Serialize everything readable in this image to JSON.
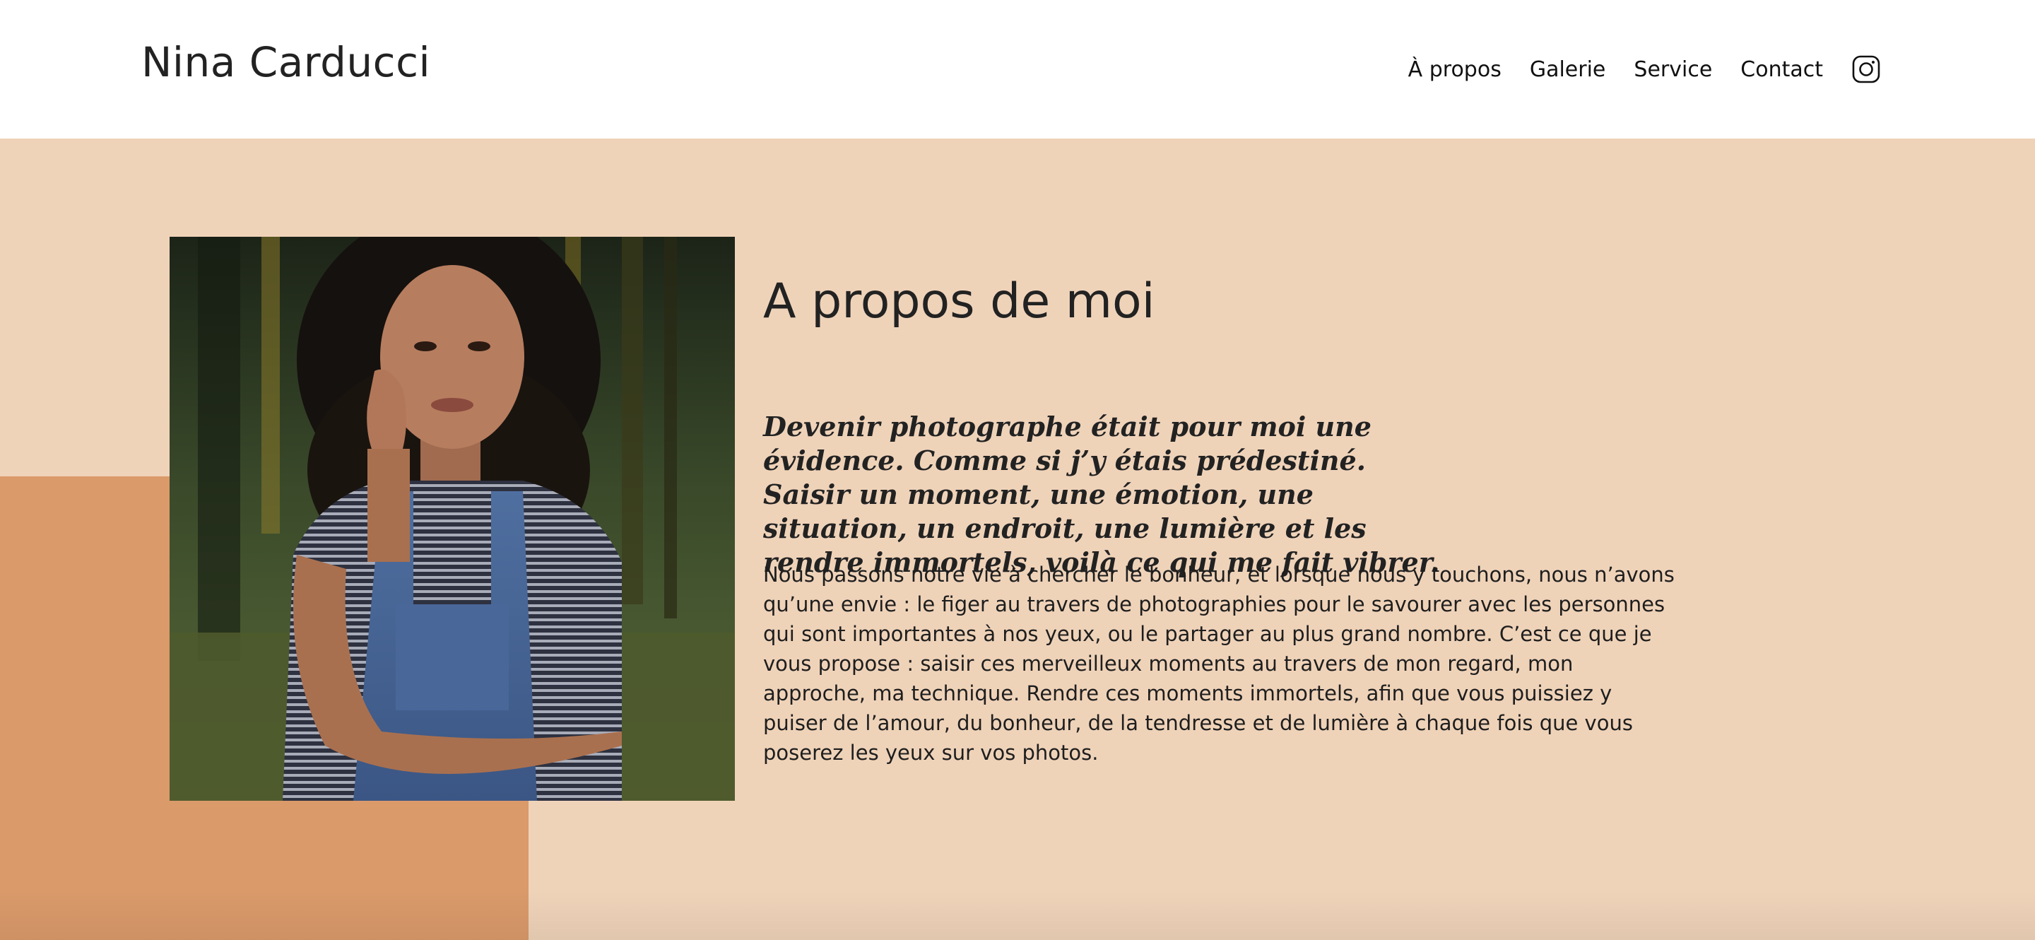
{
  "header": {
    "brand": "Nina Carducci",
    "nav": [
      {
        "label": "À propos"
      },
      {
        "label": "Galerie"
      },
      {
        "label": "Service"
      },
      {
        "label": "Contact"
      }
    ],
    "social_icon": "instagram-icon"
  },
  "about": {
    "title": "A propos de moi",
    "quote": "Devenir photographe était pour moi une évidence. Comme si j’y étais prédestiné. Saisir un moment, une émotion, une situation, un endroit, une lumière et les rendre immortels, voilà ce qui me fait vibrer.",
    "body": "Nous passons notre vie à chercher le bonheur, et lorsque nous y touchons, nous n’avons qu’une envie : le figer au travers de photographies pour le savourer avec les personnes qui sont importantes à nos yeux, ou le partager au plus grand nombre. C’est ce que je vous propose : saisir ces merveilleux moments au travers de mon regard, mon approche, ma technique. Rendre ces moments immortels, afin que vous puissiez y puiser de l’amour, du bonheur, de la tendresse et de lumière à chaque fois que vous poserez les yeux sur vos photos."
  },
  "colors": {
    "section_background": "#efd3b9",
    "accent_block": "#da9a6a",
    "text": "#222222"
  }
}
